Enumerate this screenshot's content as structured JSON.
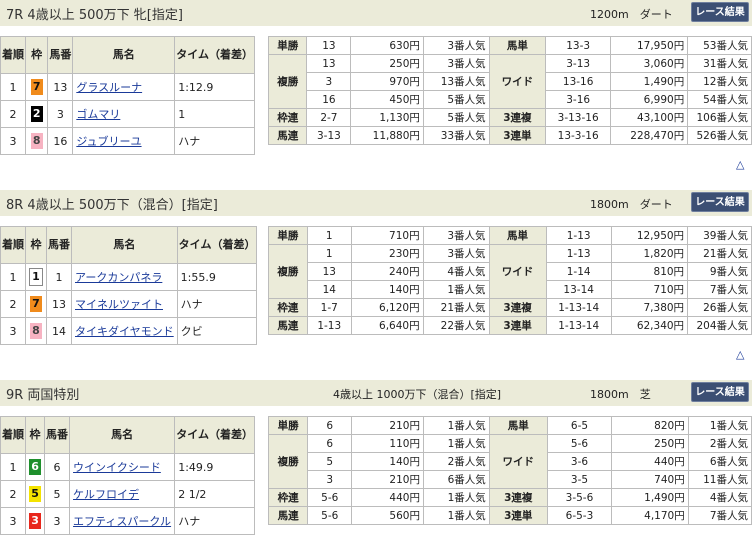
{
  "button_label": "レース結果",
  "up_arrow": "△",
  "result_headers": {
    "pos": "着順",
    "waku": "枠",
    "num": "馬番",
    "name": "馬名",
    "time": "タイム（着差）"
  },
  "pay_labels": {
    "tansho": "単勝",
    "fukusho": "複勝",
    "wakuren": "枠連",
    "umaren": "馬連",
    "umatan": "馬単",
    "wide": "ワイド",
    "sanrenpuku": "3連複",
    "sanrentan": "3連単"
  },
  "waku_colors": {
    "1": "#ffffff",
    "2": "#000000",
    "3": "#e8261b",
    "5": "#f4e300",
    "6": "#1e8f2c",
    "7": "#f08b1c",
    "8": "#f7b3c2"
  },
  "races": [
    {
      "title": "7R 4歳以上 500万下 牝[指定]",
      "condition": "",
      "distance": "1200m　ダート",
      "results": [
        {
          "pos": "1",
          "waku": "7",
          "num": "13",
          "name": "グラスルーナ",
          "time": "1:12.9"
        },
        {
          "pos": "2",
          "waku": "2",
          "num": "3",
          "name": "ゴムマリ",
          "time": "1"
        },
        {
          "pos": "3",
          "waku": "8",
          "num": "16",
          "name": "ジュブリーユ",
          "time": "ハナ"
        }
      ],
      "payouts": {
        "tansho": [
          {
            "c": "13",
            "y": "630円",
            "p": "3番人気"
          }
        ],
        "fukusho": [
          {
            "c": "13",
            "y": "250円",
            "p": "3番人気"
          },
          {
            "c": "3",
            "y": "970円",
            "p": "13番人気"
          },
          {
            "c": "16",
            "y": "450円",
            "p": "5番人気"
          }
        ],
        "wakuren": [
          {
            "c": "2-7",
            "y": "1,130円",
            "p": "5番人気"
          }
        ],
        "umaren": [
          {
            "c": "3-13",
            "y": "11,880円",
            "p": "33番人気"
          }
        ],
        "umatan": [
          {
            "c": "13-3",
            "y": "17,950円",
            "p": "53番人気"
          }
        ],
        "wide": [
          {
            "c": "3-13",
            "y": "3,060円",
            "p": "31番人気"
          },
          {
            "c": "13-16",
            "y": "1,490円",
            "p": "12番人気"
          },
          {
            "c": "3-16",
            "y": "6,990円",
            "p": "54番人気"
          }
        ],
        "sanrenpuku": [
          {
            "c": "3-13-16",
            "y": "43,100円",
            "p": "106番人気"
          }
        ],
        "sanrentan": [
          {
            "c": "13-3-16",
            "y": "228,470円",
            "p": "526番人気"
          }
        ]
      }
    },
    {
      "title": "8R 4歳以上 500万下（混合）[指定]",
      "condition": "",
      "distance": "1800m　ダート",
      "results": [
        {
          "pos": "1",
          "waku": "1",
          "num": "1",
          "name": "アークカンパネラ",
          "time": "1:55.9"
        },
        {
          "pos": "2",
          "waku": "7",
          "num": "13",
          "name": "マイネルツァイト",
          "time": "ハナ"
        },
        {
          "pos": "3",
          "waku": "8",
          "num": "14",
          "name": "タイキダイヤモンド",
          "time": "クビ"
        }
      ],
      "payouts": {
        "tansho": [
          {
            "c": "1",
            "y": "710円",
            "p": "3番人気"
          }
        ],
        "fukusho": [
          {
            "c": "1",
            "y": "230円",
            "p": "3番人気"
          },
          {
            "c": "13",
            "y": "240円",
            "p": "4番人気"
          },
          {
            "c": "14",
            "y": "140円",
            "p": "1番人気"
          }
        ],
        "wakuren": [
          {
            "c": "1-7",
            "y": "6,120円",
            "p": "21番人気"
          }
        ],
        "umaren": [
          {
            "c": "1-13",
            "y": "6,640円",
            "p": "22番人気"
          }
        ],
        "umatan": [
          {
            "c": "1-13",
            "y": "12,950円",
            "p": "39番人気"
          }
        ],
        "wide": [
          {
            "c": "1-13",
            "y": "1,820円",
            "p": "21番人気"
          },
          {
            "c": "1-14",
            "y": "810円",
            "p": "9番人気"
          },
          {
            "c": "13-14",
            "y": "710円",
            "p": "7番人気"
          }
        ],
        "sanrenpuku": [
          {
            "c": "1-13-14",
            "y": "7,380円",
            "p": "26番人気"
          }
        ],
        "sanrentan": [
          {
            "c": "1-13-14",
            "y": "62,340円",
            "p": "204番人気"
          }
        ]
      }
    },
    {
      "title": "9R 両国特別",
      "condition": "4歳以上 1000万下（混合）[指定]",
      "distance": "1800m　芝",
      "results": [
        {
          "pos": "1",
          "waku": "6",
          "num": "6",
          "name": "ウインイクシード",
          "time": "1:49.9"
        },
        {
          "pos": "2",
          "waku": "5",
          "num": "5",
          "name": "ケルフロイデ",
          "time": "2 1/2"
        },
        {
          "pos": "3",
          "waku": "3",
          "num": "3",
          "name": "エフティスパークル",
          "time": "ハナ"
        }
      ],
      "payouts": {
        "tansho": [
          {
            "c": "6",
            "y": "210円",
            "p": "1番人気"
          }
        ],
        "fukusho": [
          {
            "c": "6",
            "y": "110円",
            "p": "1番人気"
          },
          {
            "c": "5",
            "y": "140円",
            "p": "2番人気"
          },
          {
            "c": "3",
            "y": "210円",
            "p": "6番人気"
          }
        ],
        "wakuren": [
          {
            "c": "5-6",
            "y": "440円",
            "p": "1番人気"
          }
        ],
        "umaren": [
          {
            "c": "5-6",
            "y": "560円",
            "p": "1番人気"
          }
        ],
        "umatan": [
          {
            "c": "6-5",
            "y": "820円",
            "p": "1番人気"
          }
        ],
        "wide": [
          {
            "c": "5-6",
            "y": "250円",
            "p": "2番人気"
          },
          {
            "c": "3-6",
            "y": "440円",
            "p": "6番人気"
          },
          {
            "c": "3-5",
            "y": "740円",
            "p": "11番人気"
          }
        ],
        "sanrenpuku": [
          {
            "c": "3-5-6",
            "y": "1,490円",
            "p": "4番人気"
          }
        ],
        "sanrentan": [
          {
            "c": "6-5-3",
            "y": "4,170円",
            "p": "7番人気"
          }
        ]
      }
    }
  ]
}
